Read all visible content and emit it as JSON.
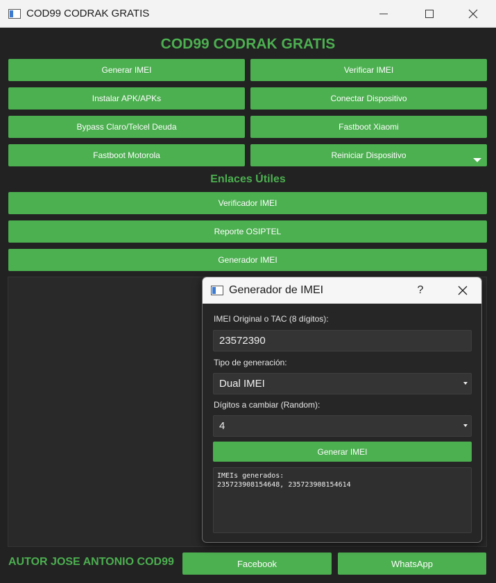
{
  "window": {
    "title": "COD99 CODRAK GRATIS"
  },
  "main": {
    "heading": "COD99 CODRAK GRATIS",
    "buttons": [
      "Generar IMEI",
      "Verificar IMEI",
      "Instalar APK/APKs",
      "Conectar Dispositivo",
      "Bypass Claro/Telcel Deuda",
      "Fastboot Xiaomi",
      "Fastboot Motorola",
      "Reiniciar Dispositivo"
    ],
    "links_heading": "Enlaces Útiles",
    "links": [
      "Verificador IMEI",
      "Reporte OSIPTEL",
      "Generador IMEI"
    ]
  },
  "footer": {
    "author": "AUTOR JOSE ANTONIO COD99",
    "facebook": "Facebook",
    "whatsapp": "WhatsApp"
  },
  "dialog": {
    "title": "Generador de IMEI",
    "help": "?",
    "imei_label": "IMEI Original o TAC (8 dígitos):",
    "imei_value": "23572390",
    "type_label": "Tipo de generación:",
    "type_value": "Dual IMEI",
    "digits_label": "Dígitos a cambiar (Random):",
    "digits_value": "4",
    "generate_label": "Generar IMEI",
    "output_line1": "IMEIs generados:",
    "output_line2": "235723908154648, 235723908154614"
  },
  "colors": {
    "accent": "#4caf50",
    "background": "#222222"
  }
}
